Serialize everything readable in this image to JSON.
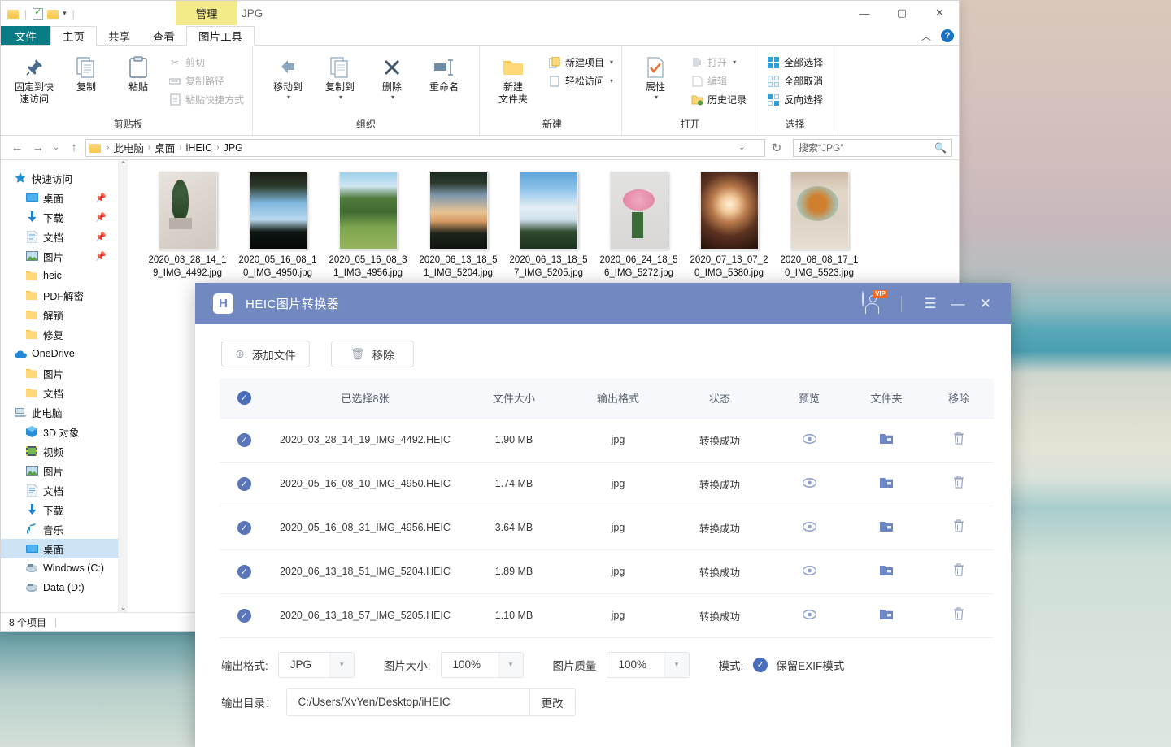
{
  "explorer": {
    "quick_access": {
      "caret": "▾"
    },
    "contextual_tab": "管理",
    "contextual_group": "JPG",
    "window_controls": {
      "minimize": "—",
      "maximize": "▢",
      "close": "✕"
    },
    "ribbon_tabs": [
      {
        "label": "文件"
      },
      {
        "label": "主页"
      },
      {
        "label": "共享"
      },
      {
        "label": "查看"
      },
      {
        "label": "图片工具"
      }
    ],
    "ribbon_collapse": "︿",
    "help": "?",
    "groups": [
      {
        "title": "剪贴板",
        "big": [
          {
            "label": "固定到快\n速访问",
            "icon": "pin-icon"
          },
          {
            "label": "复制",
            "icon": "copy-icon"
          },
          {
            "label": "粘贴",
            "icon": "paste-icon"
          }
        ],
        "small": [
          {
            "label": "剪切",
            "icon": "scissors-icon",
            "dim": true
          },
          {
            "label": "复制路径",
            "icon": "copy-path-icon",
            "dim": true
          },
          {
            "label": "粘贴快捷方式",
            "icon": "paste-shortcut-icon",
            "dim": true
          }
        ]
      },
      {
        "title": "组织",
        "big": [
          {
            "label": "移动到",
            "icon": "move-to-icon",
            "caret": "▾"
          },
          {
            "label": "复制到",
            "icon": "copy-to-icon",
            "caret": "▾"
          },
          {
            "label": "删除",
            "icon": "delete-icon",
            "caret": "▾"
          },
          {
            "label": "重命名",
            "icon": "rename-icon"
          }
        ],
        "small": []
      },
      {
        "title": "新建",
        "big": [
          {
            "label": "新建\n文件夹",
            "icon": "new-folder-icon"
          }
        ],
        "small": [
          {
            "label": "新建项目",
            "icon": "new-item-icon",
            "caret": "▾"
          },
          {
            "label": "轻松访问",
            "icon": "easy-access-icon",
            "caret": "▾"
          }
        ]
      },
      {
        "title": "打开",
        "big": [
          {
            "label": "属性",
            "icon": "properties-icon",
            "caret": "▾"
          }
        ],
        "small": [
          {
            "label": "打开",
            "icon": "open-icon",
            "caret": "▾",
            "dim": true
          },
          {
            "label": "编辑",
            "icon": "edit-icon",
            "dim": true
          },
          {
            "label": "历史记录",
            "icon": "history-icon"
          }
        ]
      },
      {
        "title": "选择",
        "big": [],
        "small": [
          {
            "label": "全部选择",
            "icon": "select-all-icon"
          },
          {
            "label": "全部取消",
            "icon": "select-none-icon"
          },
          {
            "label": "反向选择",
            "icon": "invert-selection-icon"
          }
        ]
      }
    ],
    "address": {
      "back": "←",
      "forward": "→",
      "recent": "⌄",
      "up": "↑",
      "breadcrumbs": [
        "此电脑",
        "桌面",
        "iHEIC",
        "JPG"
      ],
      "separator": "›",
      "dropdown": "⌄",
      "refresh": "↻"
    },
    "search": {
      "placeholder": "搜索“JPG”",
      "icon": "search-icon"
    },
    "nav_items": [
      {
        "label": "快速访问",
        "icon": "star-icon",
        "level": 0,
        "pinned": false
      },
      {
        "label": "桌面",
        "icon": "desktop-icon",
        "level": 1,
        "pinned": true
      },
      {
        "label": "下载",
        "icon": "downloads-icon",
        "level": 1,
        "pinned": true
      },
      {
        "label": "文档",
        "icon": "documents-icon",
        "level": 1,
        "pinned": true
      },
      {
        "label": "图片",
        "icon": "pictures-icon",
        "level": 1,
        "pinned": true
      },
      {
        "label": "heic",
        "icon": "folder-icon",
        "level": 1,
        "pinned": false
      },
      {
        "label": "PDF解密",
        "icon": "folder-icon",
        "level": 1,
        "pinned": false
      },
      {
        "label": "解锁",
        "icon": "folder-icon",
        "level": 1,
        "pinned": false
      },
      {
        "label": "修复",
        "icon": "folder-icon",
        "level": 1,
        "pinned": false
      },
      {
        "label": "OneDrive",
        "icon": "cloud-icon",
        "level": 0,
        "pinned": false
      },
      {
        "label": "图片",
        "icon": "folder-icon",
        "level": 1,
        "pinned": false
      },
      {
        "label": "文档",
        "icon": "folder-icon",
        "level": 1,
        "pinned": false
      },
      {
        "label": "此电脑",
        "icon": "computer-icon",
        "level": 0,
        "pinned": false
      },
      {
        "label": "3D 对象",
        "icon": "3d-objects-icon",
        "level": 1,
        "pinned": false
      },
      {
        "label": "视频",
        "icon": "videos-icon",
        "level": 1,
        "pinned": false
      },
      {
        "label": "图片",
        "icon": "pictures-icon",
        "level": 1,
        "pinned": false
      },
      {
        "label": "文档",
        "icon": "documents-icon",
        "level": 1,
        "pinned": false
      },
      {
        "label": "下载",
        "icon": "downloads-icon",
        "level": 1,
        "pinned": false
      },
      {
        "label": "音乐",
        "icon": "music-icon",
        "level": 1,
        "pinned": false
      },
      {
        "label": "桌面",
        "icon": "desktop-icon",
        "level": 1,
        "pinned": false,
        "selected": true
      },
      {
        "label": "Windows (C:)",
        "icon": "drive-icon",
        "level": 1,
        "pinned": false
      },
      {
        "label": "Data (D:)",
        "icon": "drive-icon",
        "level": 1,
        "pinned": false
      }
    ],
    "nav_scroll": {
      "up": "⌃",
      "down": "⌄"
    },
    "files": [
      {
        "name": "2020_03_28_14_19_IMG_4492.jpg",
        "thumb": "room-plant"
      },
      {
        "name": "2020_05_16_08_10_IMG_4950.jpg",
        "thumb": "palm-sky"
      },
      {
        "name": "2020_05_16_08_31_IMG_4956.jpg",
        "thumb": "green-path"
      },
      {
        "name": "2020_06_13_18_51_IMG_5204.jpg",
        "thumb": "sunset-trees"
      },
      {
        "name": "2020_06_13_18_57_IMG_5205.jpg",
        "thumb": "cloud-sky"
      },
      {
        "name": "2020_06_24_18_56_IMG_5272.jpg",
        "thumb": "pink-roses"
      },
      {
        "name": "2020_07_13_07_20_IMG_5380.jpg",
        "thumb": "ring-light-bottle"
      },
      {
        "name": "2020_08_08_17_10_IMG_5523.jpg",
        "thumb": "food-plate"
      }
    ],
    "status": "8 个项目"
  },
  "heic_app": {
    "title": "HEIC图片转换器",
    "logo_letter": "H",
    "avatar_badge": "VIP",
    "window_controls": {
      "menu": "☰",
      "minimize": "—",
      "close": "✕"
    },
    "toolbar": [
      {
        "label": "添加文件",
        "icon": "plus-circle-icon"
      },
      {
        "label": "移除",
        "icon": "trash-icon"
      }
    ],
    "table": {
      "headers": [
        "已选择8张",
        "文件大小",
        "输出格式",
        "状态",
        "预览",
        "文件夹",
        "移除"
      ],
      "header_check": "✓",
      "rows": [
        {
          "name": "2020_03_28_14_19_IMG_4492.HEIC",
          "size": "1.90 MB",
          "format": "jpg",
          "status": "转换成功"
        },
        {
          "name": "2020_05_16_08_10_IMG_4950.HEIC",
          "size": "1.74 MB",
          "format": "jpg",
          "status": "转换成功"
        },
        {
          "name": "2020_05_16_08_31_IMG_4956.HEIC",
          "size": "3.64 MB",
          "format": "jpg",
          "status": "转换成功"
        },
        {
          "name": "2020_06_13_18_51_IMG_5204.HEIC",
          "size": "1.89 MB",
          "format": "jpg",
          "status": "转换成功"
        },
        {
          "name": "2020_06_13_18_57_IMG_5205.HEIC",
          "size": "1.10 MB",
          "format": "jpg",
          "status": "转换成功"
        }
      ],
      "row_check": "✓",
      "preview_icon": "eye-icon",
      "folder_icon": "folder-icon",
      "remove_icon": "trash-icon"
    },
    "settings": {
      "output_format_label": "输出格式:",
      "output_format_value": "JPG",
      "image_size_label": "图片大小:",
      "image_size_value": "100%",
      "image_quality_label": "图片质量",
      "image_quality_value": "100%",
      "mode_label": "模式:",
      "mode_value": "保留EXIF模式",
      "mode_check": "✓",
      "output_dir_label": "输出目录：",
      "output_dir_value": "C:/Users/XvYen/Desktop/iHEIC",
      "change_label": "更改",
      "caret": "▾"
    },
    "accent_color": "#7189c0",
    "success_color": "#3ddc4a"
  }
}
